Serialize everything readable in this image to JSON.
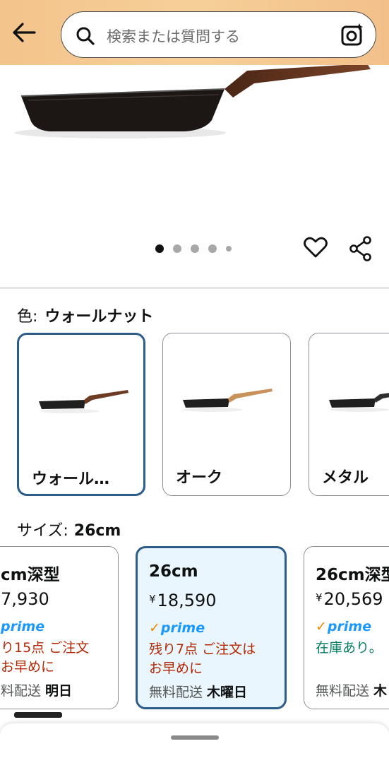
{
  "header": {
    "search_placeholder": "検索または質問する",
    "icons": {
      "back": "arrow-left-icon",
      "search": "search-icon",
      "lens": "camera-lens-icon"
    }
  },
  "gallery": {
    "image_count": 5,
    "active_index": 0,
    "icons": {
      "wishlist": "heart-icon",
      "share": "share-icon"
    }
  },
  "color": {
    "label": "色:",
    "selected": "ウォールナット",
    "options": [
      {
        "label": "ウォール…",
        "handle_color": "#6b3b24",
        "selected": true
      },
      {
        "label": "オーク",
        "handle_color": "#c9925a",
        "selected": false
      },
      {
        "label": "メタル",
        "handle_color": "#2e2e2e",
        "selected": false
      }
    ]
  },
  "size": {
    "label": "サイズ:",
    "selected": "26cm",
    "options": [
      {
        "name": "cm深型",
        "yen": "",
        "price": "7,930",
        "prime": "prime",
        "stock": "り15点 ご注文\nお早めに",
        "stock_type": "red",
        "ship": "料配送",
        "ship_day": "明日",
        "selected": false
      },
      {
        "name": "26cm",
        "yen": "¥",
        "price": "18,590",
        "prime": "prime",
        "stock": "残り7点 ご注文は\nお早めに",
        "stock_type": "red",
        "ship": "無料配送",
        "ship_day": "木曜日",
        "selected": true
      },
      {
        "name": "26cm深型",
        "yen": "¥",
        "price": "20,569",
        "prime": "prime",
        "stock": "在庫あり。",
        "stock_type": "green",
        "ship": "無料配送",
        "ship_day": "木",
        "selected": false
      }
    ]
  },
  "colors": {
    "header_bg": "#f5c992",
    "selected_border": "#2b5c8a",
    "prime_blue": "#1a98ff",
    "prime_check": "#f08804",
    "stock_red": "#b12704",
    "stock_green": "#067d62"
  }
}
